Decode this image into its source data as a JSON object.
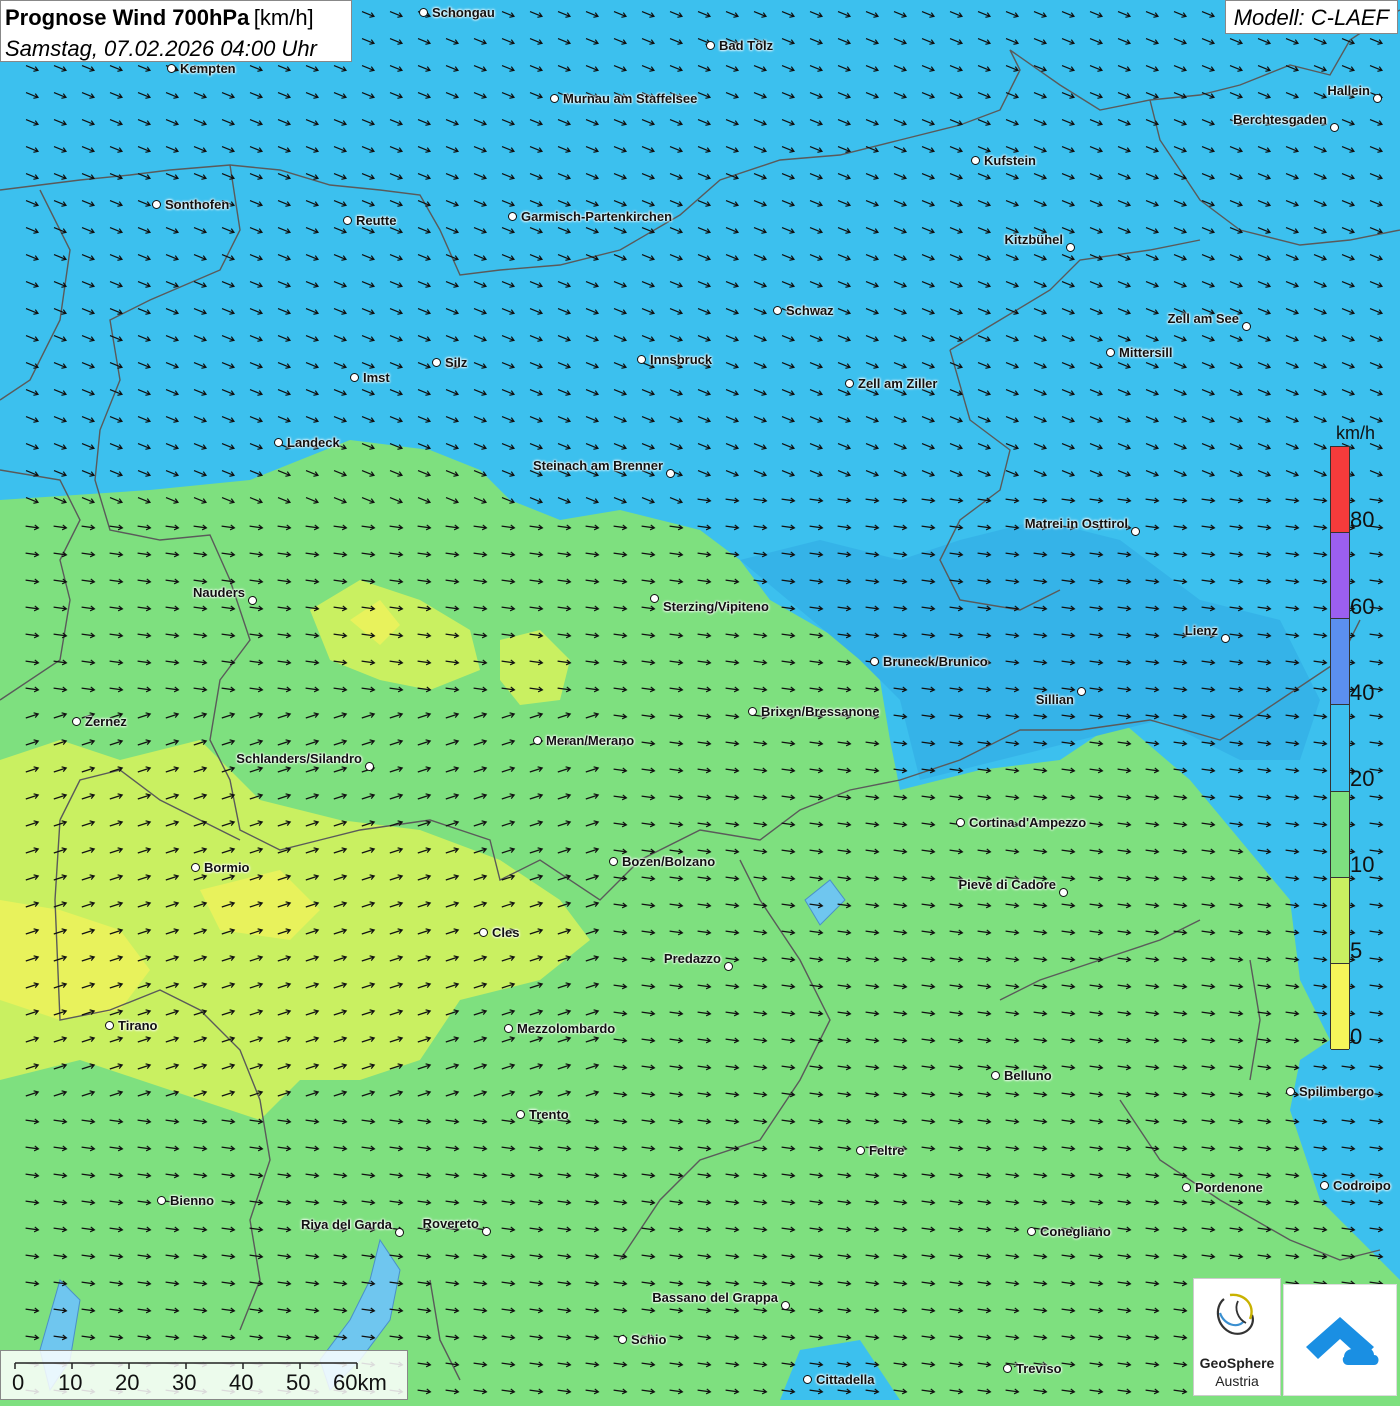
{
  "title": {
    "main": "Prognose Wind 700hPa",
    "unit": "[km/h]",
    "datetime": "Samstag, 07.02.2026 04:00 Uhr"
  },
  "model": "Modell: C-LAEF",
  "legend": {
    "unit": "km/h",
    "ticks": [
      "80",
      "60",
      "40",
      "20",
      "10",
      "5",
      "0"
    ],
    "colors": [
      "#f53b3b",
      "#9b5ff0",
      "#5b8ff0",
      "#3cc0ee",
      "#7ee07f",
      "#c9f061",
      "#f6f55a"
    ]
  },
  "scale": {
    "labels": [
      "0",
      "10",
      "20",
      "30",
      "40",
      "50",
      "60km"
    ]
  },
  "logos": {
    "geosphere_name": "GeoSphere",
    "geosphere_sub": "Austria",
    "geosphere_icon": "geosphere-swirl-icon",
    "app_icon": "weather-app-icon"
  },
  "cities": [
    {
      "name": "Schongau"
    },
    {
      "name": "Bad Tölz"
    },
    {
      "name": "Kempten"
    },
    {
      "name": "Murnau am Staffelsee"
    },
    {
      "name": "Hallein"
    },
    {
      "name": "Berchtesgaden"
    },
    {
      "name": "Kufstein"
    },
    {
      "name": "Sonthofen"
    },
    {
      "name": "Reutte"
    },
    {
      "name": "Garmisch-Partenkirchen"
    },
    {
      "name": "Kitzbühel"
    },
    {
      "name": "Schwaz"
    },
    {
      "name": "Zell am See"
    },
    {
      "name": "Mittersill"
    },
    {
      "name": "Innsbruck"
    },
    {
      "name": "Silz"
    },
    {
      "name": "Imst"
    },
    {
      "name": "Zell am Ziller"
    },
    {
      "name": "Landeck"
    },
    {
      "name": "Steinach am Brenner"
    },
    {
      "name": "Matrei in Osttirol"
    },
    {
      "name": "Nauders"
    },
    {
      "name": "Sterzing/Vipiteno"
    },
    {
      "name": "Lienz"
    },
    {
      "name": "Bruneck/Brunico"
    },
    {
      "name": "Sillian"
    },
    {
      "name": "Zernez"
    },
    {
      "name": "Brixen/Bressanone"
    },
    {
      "name": "Meran/Merano"
    },
    {
      "name": "Schlanders/Silandro"
    },
    {
      "name": "Cortina d'Ampezzo"
    },
    {
      "name": "Bozen/Bolzano"
    },
    {
      "name": "Bormio"
    },
    {
      "name": "Pieve di Cadore"
    },
    {
      "name": "Cles"
    },
    {
      "name": "Predazzo"
    },
    {
      "name": "Tirano"
    },
    {
      "name": "Mezzolombardo"
    },
    {
      "name": "Belluno"
    },
    {
      "name": "Spilimbergo"
    },
    {
      "name": "Trento"
    },
    {
      "name": "Feltre"
    },
    {
      "name": "Pordenone"
    },
    {
      "name": "Codroipo"
    },
    {
      "name": "Bienno"
    },
    {
      "name": "Riva del Garda"
    },
    {
      "name": "Rovereto"
    },
    {
      "name": "Conegliano"
    },
    {
      "name": "Bassano del Grappa"
    },
    {
      "name": "Schio"
    },
    {
      "name": "Treviso"
    },
    {
      "name": "Cittadella"
    }
  ]
}
